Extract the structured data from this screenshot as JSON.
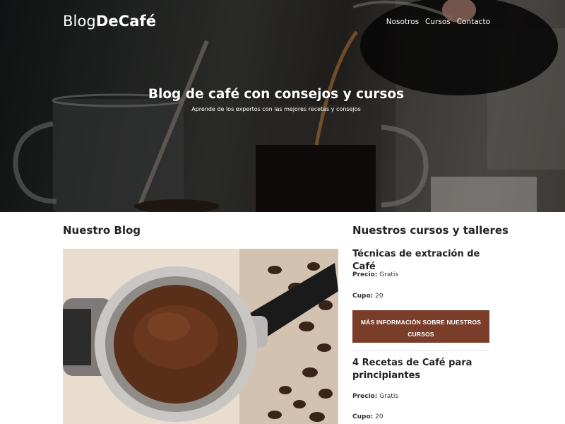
{
  "brand": {
    "logo_light": "Blog",
    "logo_bold": "DeCafé"
  },
  "nav": {
    "items": [
      "Nosotros",
      "Cursos",
      "Contacto"
    ]
  },
  "hero": {
    "title": "Blog de café con consejos y cursos",
    "subtitle": "Aprende de los expertos con las mejores recetas y consejos"
  },
  "blog": {
    "title": "Nuestro Blog"
  },
  "courses": {
    "title": "Nuestros cursos y talleres",
    "items": [
      {
        "title": "Técnicas de extración de Café",
        "price_label": "Precio:",
        "price": "Gratis",
        "quota_label": "Cupo:",
        "quota": "20",
        "button": "MÁS INFORMACIÓN SOBRE NUESTROS CURSOS"
      },
      {
        "title": "4 Recetas de Café para principiantes",
        "price_label": "Precio:",
        "price": "Gratis",
        "quota_label": "Cupo:",
        "quota": "20"
      }
    ]
  },
  "colors": {
    "accent": "#7a3d2a",
    "hero_overlay": "#000000",
    "text": "#222222"
  }
}
